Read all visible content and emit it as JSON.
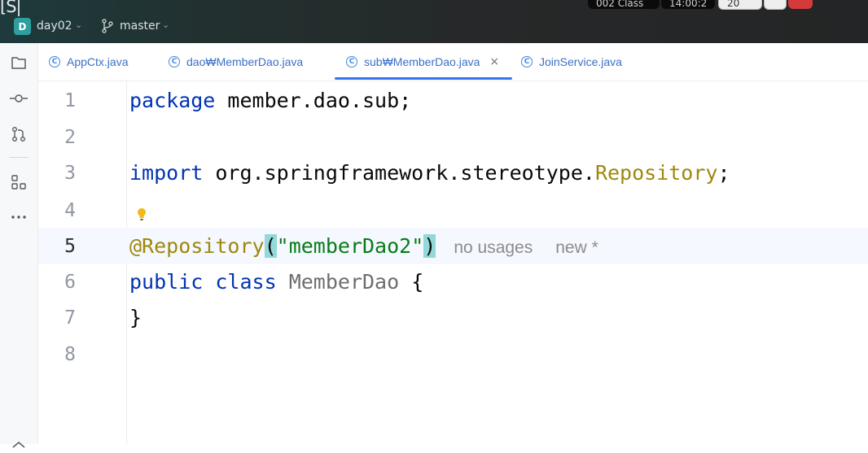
{
  "titlebar": {
    "corner_text": "[S|",
    "project_initial": "D",
    "project_name": "day02",
    "branch_name": "master",
    "overlay": {
      "item1": "002 Class",
      "item2": "14:00:2",
      "item3": "20"
    }
  },
  "toolstrip": {
    "items": [
      {
        "icon": "folder-icon"
      },
      {
        "icon": "commit-icon"
      },
      {
        "icon": "pull-requests-icon"
      },
      {
        "icon": "structure-icon"
      },
      {
        "icon": "more-icon"
      }
    ]
  },
  "tabs": [
    {
      "label": "AppCtx.java",
      "icon_letter": "C",
      "active": false
    },
    {
      "label": "dao₩MemberDao.java",
      "icon_letter": "C",
      "active": false
    },
    {
      "label": "sub₩MemberDao.java",
      "icon_letter": "C",
      "active": true,
      "close": "×"
    },
    {
      "label": "JoinService.java",
      "icon_letter": "C",
      "active": false
    }
  ],
  "editor": {
    "line_numbers": [
      "1",
      "2",
      "3",
      "4",
      "5",
      "6",
      "7",
      "8"
    ],
    "active_line": 5,
    "lines": {
      "l1": {
        "kw": "package",
        "rest": " member.dao.sub;"
      },
      "l3": {
        "kw": "import",
        "rest": " org.springframework.stereotype.",
        "ann": "Repository",
        "end": ";"
      },
      "l5": {
        "ann": "@Repository",
        "open": "(",
        "str": "\"memberDao2\"",
        "close": ")",
        "hint_usages": "no usages",
        "hint_new": "new *"
      },
      "l6": {
        "kw1": "public",
        "kw2": "class",
        "name": "MemberDao",
        "brace": "{"
      },
      "l7": {
        "brace": "}"
      }
    }
  },
  "colors": {
    "keyword": "#0033b3",
    "annotation": "#9e880d",
    "string": "#067d17",
    "tab_accent": "#3574f0",
    "project_badge": "#2f9ea0"
  }
}
